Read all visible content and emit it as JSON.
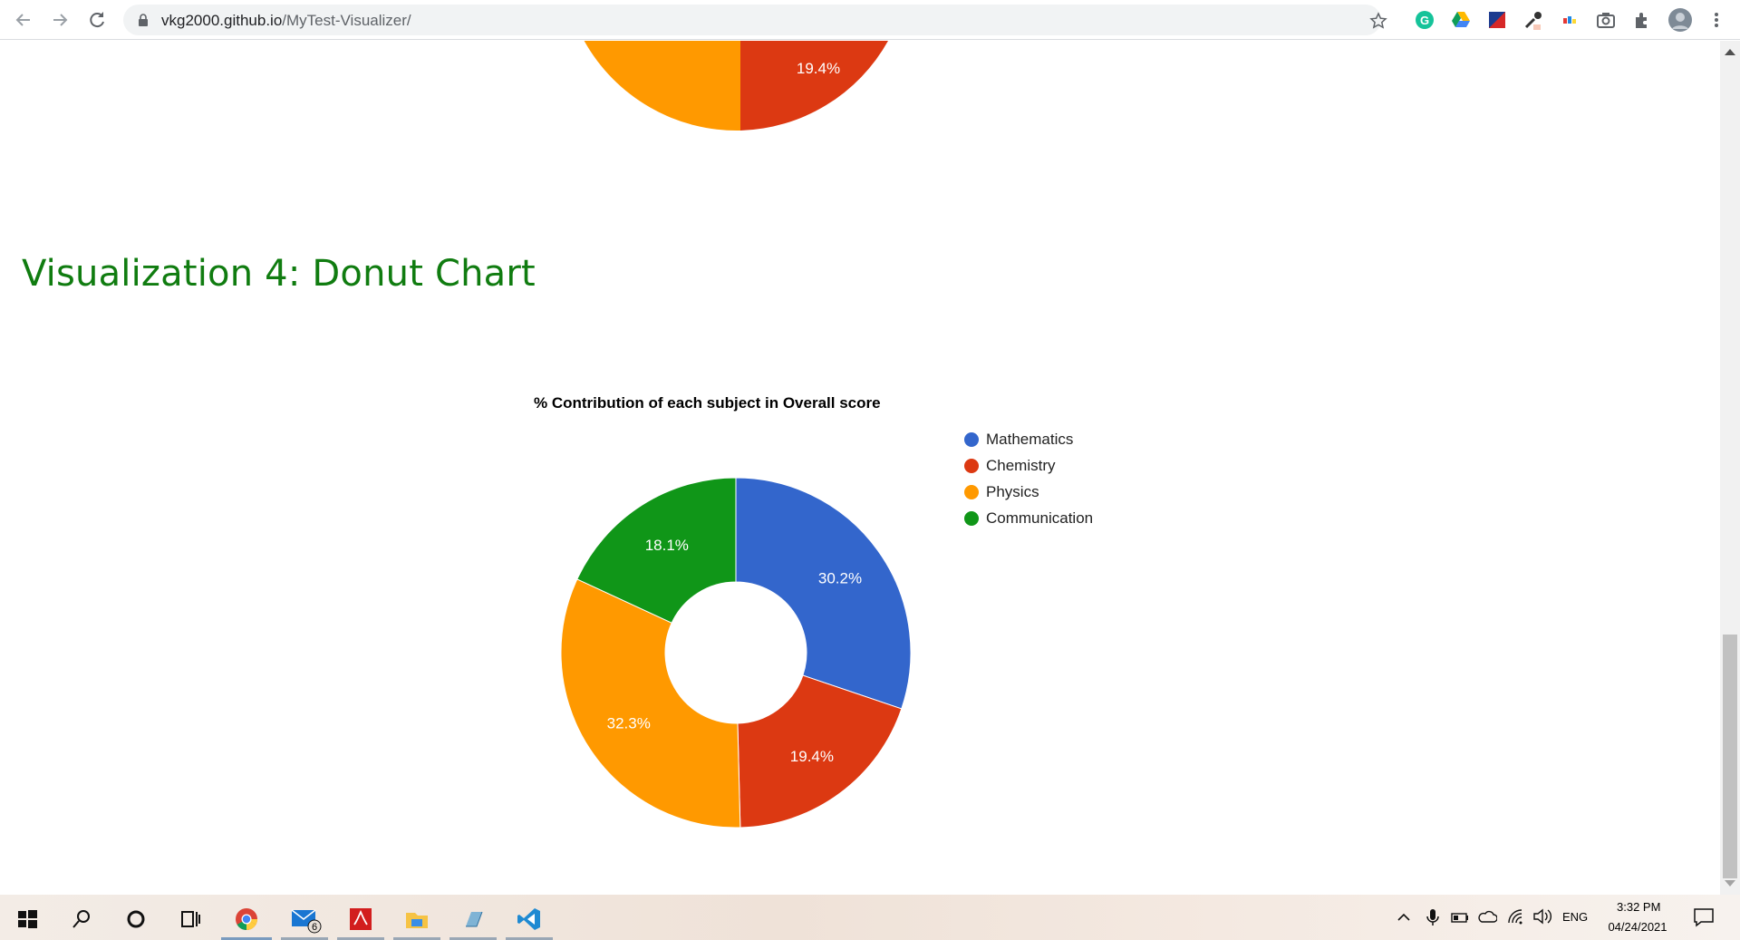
{
  "browser": {
    "url_host": "vkg2000.github.io",
    "url_path": "/MyTest-Visualizer/"
  },
  "page": {
    "top_pie_label": "19.4%",
    "heading": "Visualization 4: Donut Chart"
  },
  "chart_data": {
    "type": "pie",
    "title": "% Contribution of each subject in Overall score",
    "categories": [
      "Mathematics",
      "Chemistry",
      "Physics",
      "Communication"
    ],
    "values": [
      30.2,
      19.4,
      32.3,
      18.1
    ],
    "labels": [
      "30.2%",
      "19.4%",
      "32.3%",
      "18.1%"
    ],
    "colors": [
      "#3366cc",
      "#dc3912",
      "#ff9900",
      "#109618"
    ],
    "donut": true,
    "legend": "right"
  },
  "taskbar": {
    "mail_badge": "6",
    "tray_language": "ENG",
    "clock_time": "3:32 PM",
    "clock_date": "04/24/2021"
  }
}
